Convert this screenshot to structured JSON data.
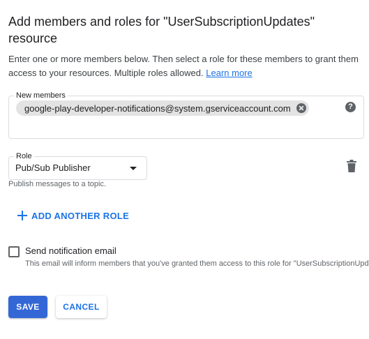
{
  "dialog": {
    "title": "Add members and roles for \"UserSubscriptionUpdates\" resource",
    "description": "Enter one or more members below. Then select a role for these members to grant them access to your resources. Multiple roles allowed.",
    "learn_more": "Learn more"
  },
  "members": {
    "label": "New members",
    "chips": [
      "google-play-developer-notifications@system.gserviceaccount.com"
    ],
    "help_icon": "help-circle-icon"
  },
  "role": {
    "label": "Role",
    "value": "Pub/Sub Publisher",
    "hint": "Publish messages to a topic.",
    "delete_icon": "trash-icon"
  },
  "add_role": {
    "label": "ADD ANOTHER ROLE",
    "icon": "plus-icon"
  },
  "notification": {
    "label": "Send notification email",
    "checked": false,
    "hint": "This email will inform members that you've granted them access to this role for \"UserSubscriptionUpdates\""
  },
  "buttons": {
    "save": "SAVE",
    "cancel": "CANCEL"
  },
  "colors": {
    "primary": "#1a73e8",
    "save_bg": "#3367d6",
    "chip_bg": "#e3e3e3"
  }
}
